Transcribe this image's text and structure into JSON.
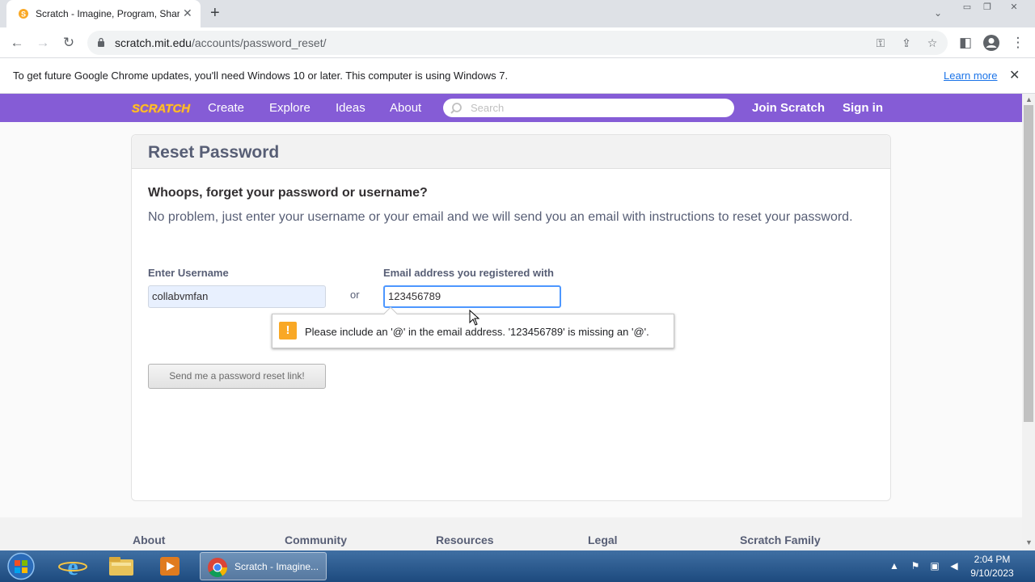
{
  "browser": {
    "tab_title": "Scratch - Imagine, Program, Share",
    "new_tab": "+",
    "tab_close": "✕",
    "url_host": "scratch.mit.edu",
    "url_path": "/accounts/password_reset/",
    "infobar_text": "To get future Google Chrome updates, you'll need Windows 10 or later. This computer is using Windows 7.",
    "learn_more": "Learn more",
    "info_close": "✕"
  },
  "scratch_nav": {
    "logo_text": "SCRATCH",
    "links": [
      "Create",
      "Explore",
      "Ideas",
      "About"
    ],
    "search_placeholder": "Search",
    "join": "Join Scratch",
    "signin": "Sign in"
  },
  "card": {
    "title": "Reset Password",
    "question": "Whoops, forget your password or username?",
    "description": "No problem, just enter your username or your email and we will send you an email with instructions to reset your password.",
    "username_label": "Enter Username",
    "username_value": "collabvmfan",
    "or": "or",
    "email_label": "Email address you registered with",
    "email_value": "123456789",
    "tooltip": "Please include an '@' in the email address. '123456789' is missing an '@'.",
    "tooltip_icon": "!",
    "send_button": "Send me a password reset link!"
  },
  "footer": {
    "headings": [
      "About",
      "Community",
      "Resources",
      "Legal",
      "Scratch Family"
    ]
  },
  "taskbar": {
    "chrome_label": "Scratch - Imagine...",
    "time": "2:04 PM",
    "date": "9/10/2023"
  },
  "colors": {
    "scratch_purple": "#855cd6",
    "focus_blue": "#4d97ff",
    "warning_orange": "#f9a825"
  }
}
